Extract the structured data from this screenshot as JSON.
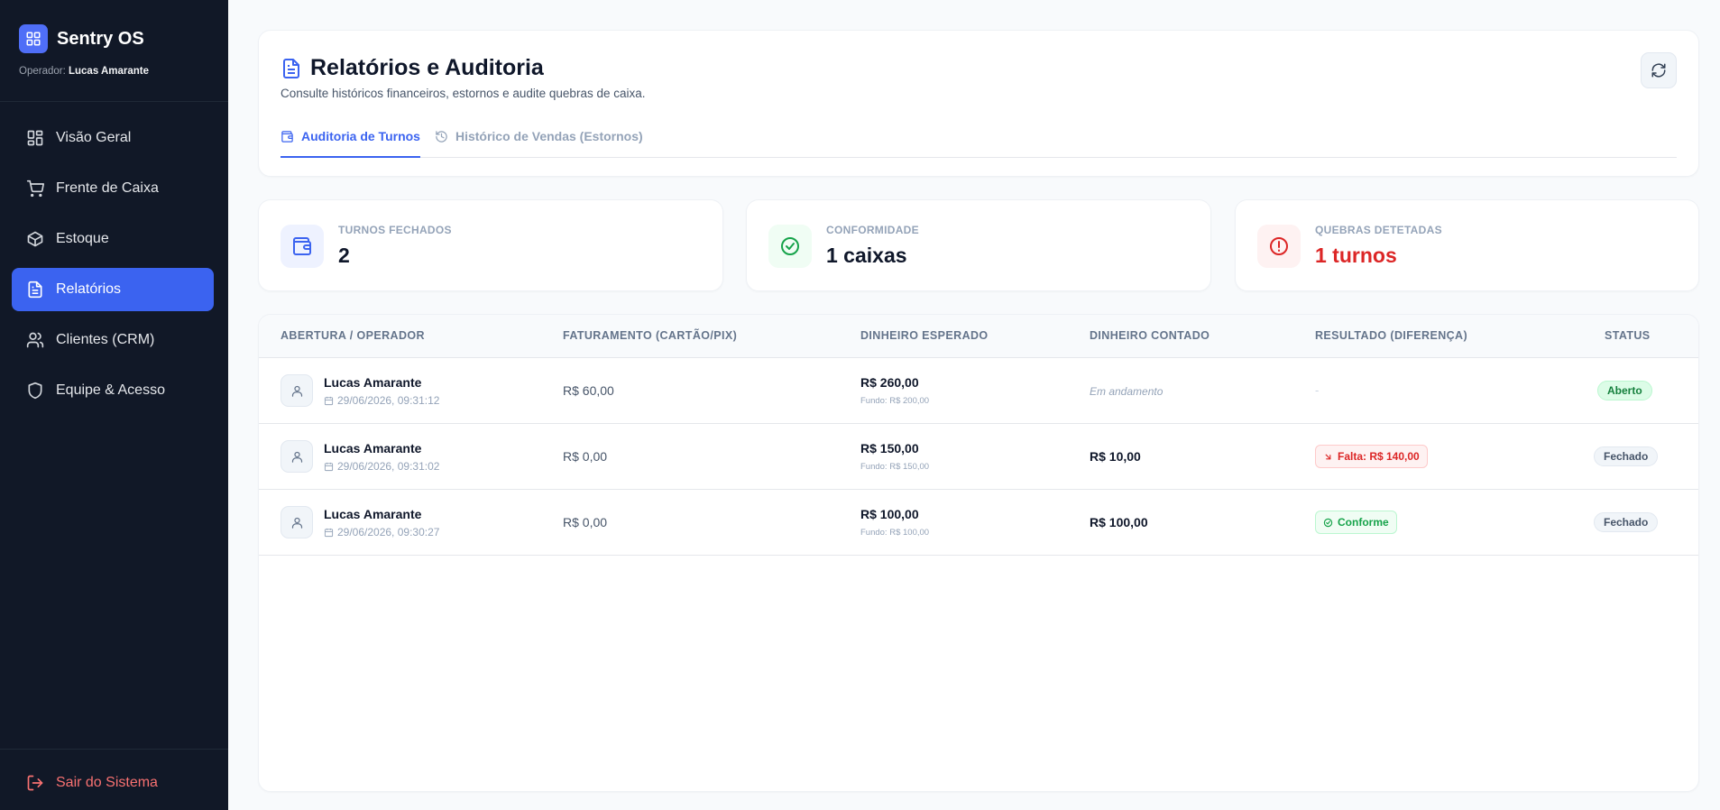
{
  "app": {
    "brand": "Sentry OS",
    "operator_label": "Operador:",
    "operator_name": "Lucas Amarante"
  },
  "sidebar": {
    "items": [
      {
        "label": "Visão Geral",
        "icon": "grid-icon"
      },
      {
        "label": "Frente de Caixa",
        "icon": "cart-icon"
      },
      {
        "label": "Estoque",
        "icon": "box-icon"
      },
      {
        "label": "Relatórios",
        "icon": "document-icon",
        "active": true
      },
      {
        "label": "Clientes (CRM)",
        "icon": "users-icon"
      },
      {
        "label": "Equipe & Acesso",
        "icon": "shield-icon"
      }
    ],
    "logout_label": "Sair do Sistema"
  },
  "header": {
    "title": "Relatórios e Auditoria",
    "subtitle": "Consulte históricos financeiros, estornos e audite quebras de caixa.",
    "tabs": [
      {
        "label": "Auditoria de Turnos",
        "active": true
      },
      {
        "label": "Histórico de Vendas (Estornos)",
        "active": false
      }
    ]
  },
  "stats": [
    {
      "label": "TURNOS FECHADOS",
      "value": "2",
      "color": "#3b63f0"
    },
    {
      "label": "CONFORMIDADE",
      "value": "1 caixas",
      "color": "#16a34a"
    },
    {
      "label": "QUEBRAS DETETADAS",
      "value": "1 turnos",
      "color": "#dc2626"
    }
  ],
  "table": {
    "columns": [
      "ABERTURA / OPERADOR",
      "FATURAMENTO (CARTÃO/PIX)",
      "DINHEIRO ESPERADO",
      "DINHEIRO CONTADO",
      "RESULTADO (DIFERENÇA)",
      "STATUS"
    ],
    "rows": [
      {
        "operator": "Lucas Amarante",
        "date": "29/06/2026, 09:31:12",
        "revenue": "R$ 60,00",
        "expected": "R$ 260,00",
        "fund": "Fundo: R$ 200,00",
        "counted": "Em andamento",
        "result": "-",
        "status": "Aberto"
      },
      {
        "operator": "Lucas Amarante",
        "date": "29/06/2026, 09:31:02",
        "revenue": "R$ 0,00",
        "expected": "R$ 150,00",
        "fund": "Fundo: R$ 150,00",
        "counted": "R$ 10,00",
        "result": "Falta: R$ 140,00",
        "status": "Fechado"
      },
      {
        "operator": "Lucas Amarante",
        "date": "29/06/2026, 09:30:27",
        "revenue": "R$ 0,00",
        "expected": "R$ 100,00",
        "fund": "Fundo: R$ 100,00",
        "counted": "R$ 100,00",
        "result": "Conforme",
        "status": "Fechado"
      }
    ]
  },
  "colors": {
    "accent": "#3b63f0",
    "sidebar_bg": "#111827",
    "danger": "#dc2626",
    "success": "#16a34a"
  }
}
